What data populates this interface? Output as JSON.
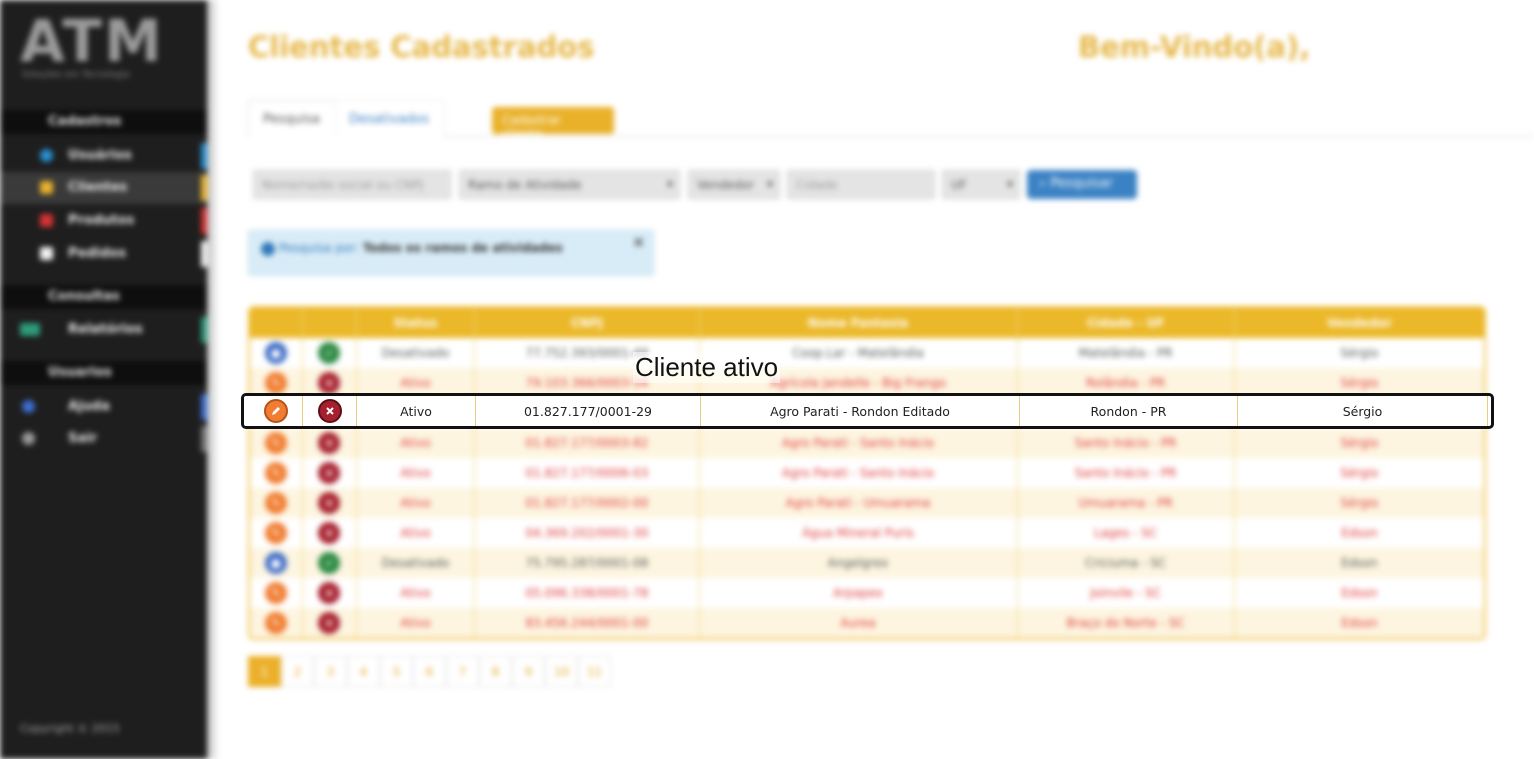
{
  "colors": {
    "accent": "#ebb829",
    "sidebar_bg": "#1e1e1e",
    "danger": "#e03a3a",
    "primary": "#3b82c4"
  },
  "sidebar": {
    "logo": "ATM",
    "logo_sub": "Soluções em Tecnologia",
    "sections": [
      {
        "title": "Cadastros",
        "items": [
          "Usuários",
          "Clientes",
          "Produtos",
          "Pedidos"
        ]
      },
      {
        "title": "Consultas",
        "items": [
          "Relatórios"
        ]
      },
      {
        "title": "Usuarios",
        "items": [
          "Ajuda",
          "Sair"
        ]
      }
    ],
    "copyright": "Copyright © 2015"
  },
  "header": {
    "title": "Clientes Cadastrados",
    "welcome": "Bem-Vindo(a),"
  },
  "tabs": [
    "Pesquisa",
    "Desativados"
  ],
  "cadastrar_label": "Cadastrar cliente",
  "filters": {
    "search_placeholder": "Nome/razão social ou CNPJ",
    "ramo": "Ramo de Atividade",
    "vendedor": "Vendedor",
    "cidade_placeholder": "Cidade",
    "uf": "UF",
    "search_button": "Pesquisar"
  },
  "alert": {
    "prefix": "Pesquisa por:",
    "text": "Todos os ramos de atividades"
  },
  "table": {
    "headers": [
      "",
      "",
      "Status",
      "CNPJ",
      "Nome Fantasia",
      "Cidade - UF",
      "Vendedor"
    ],
    "rows": [
      {
        "status": "Desativado",
        "cnpj": "77.752.393/0001-49",
        "nome": "Coop.Lar - Matelândia",
        "cidade": "Matelândia - PR",
        "vendedor": "Sérgio",
        "active": false
      },
      {
        "status": "Ativo",
        "cnpj": "79.103.366/0003-54",
        "nome": "Agrícola Jandelle - Big Frango",
        "cidade": "Rolândia - PR",
        "vendedor": "Sérgio",
        "active": true
      },
      {
        "status": "Ativo",
        "cnpj": "01.827.177/0001-29",
        "nome": "Agro Parati - Rondon Editado",
        "cidade": "Rondon - PR",
        "vendedor": "Sérgio",
        "active": true
      },
      {
        "status": "Ativo",
        "cnpj": "01.827.177/0003-82",
        "nome": "Agro Parati - Santo Inácio",
        "cidade": "Santo Inácio - PR",
        "vendedor": "Sérgio",
        "active": true
      },
      {
        "status": "Ativo",
        "cnpj": "01.827.177/0006-03",
        "nome": "Agro Parati - Santo Inácio",
        "cidade": "Santo Inácio - PR",
        "vendedor": "Sérgio",
        "active": true
      },
      {
        "status": "Ativo",
        "cnpj": "01.827.177/0002-00",
        "nome": "Agro Parati - Umuarama",
        "cidade": "Umuarama - PR",
        "vendedor": "Sérgio",
        "active": true
      },
      {
        "status": "Ativo",
        "cnpj": "04.369.202/0001-30",
        "nome": "Água Mineral Puris",
        "cidade": "Lages - SC",
        "vendedor": "Edson",
        "active": true
      },
      {
        "status": "Desativado",
        "cnpj": "75.795.287/0001-08",
        "nome": "Angelgrex",
        "cidade": "Criciuma - SC",
        "vendedor": "Edson",
        "active": false
      },
      {
        "status": "Ativo",
        "cnpj": "05.096.338/0001-78",
        "nome": "Arpapex",
        "cidade": "Joinvile - SC",
        "vendedor": "Edson",
        "active": true
      },
      {
        "status": "Ativo",
        "cnpj": "83.456.244/0001-00",
        "nome": "Aurea",
        "cidade": "Braço do Norte - SC",
        "vendedor": "Edson",
        "active": true
      }
    ]
  },
  "pagination": [
    "1",
    "2",
    "3",
    "4",
    "5",
    "6",
    "7",
    "8",
    "9",
    "10",
    "11"
  ],
  "highlight": {
    "callout": "Cliente ativo",
    "status": "Ativo",
    "cnpj": "01.827.177/0001-29",
    "nome": "Agro Parati - Rondon Editado",
    "cidade": "Rondon - PR",
    "vendedor": "Sérgio"
  }
}
